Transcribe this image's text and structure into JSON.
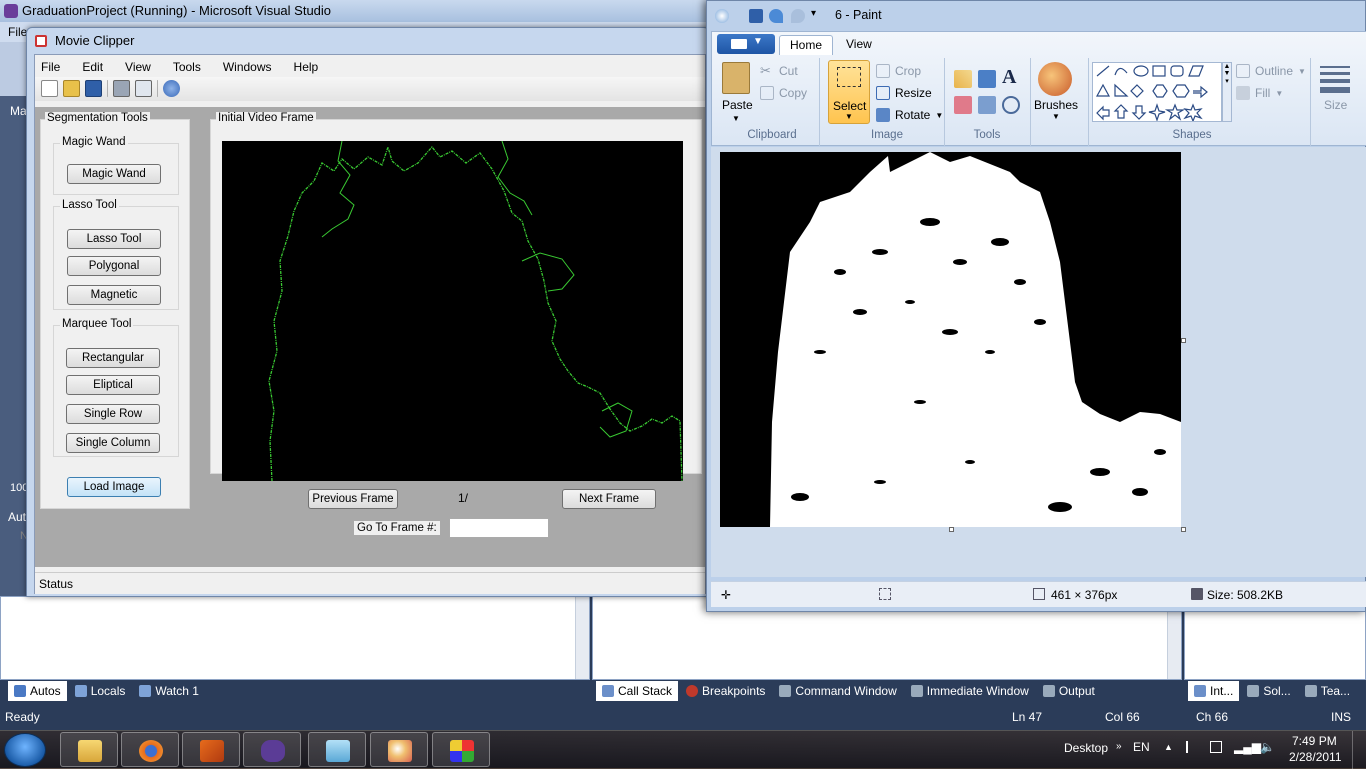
{
  "vs": {
    "title": "GraduationProject (Running) - Microsoft Visual Studio",
    "menu_first": "File",
    "left_labels": [
      "Ma",
      "100",
      "Auto",
      "N"
    ],
    "bottom_left_tabs": [
      "Autos",
      "Locals",
      "Watch 1"
    ],
    "bottom_mid_tabs": [
      "Call Stack",
      "Breakpoints",
      "Command Window",
      "Immediate Window",
      "Output"
    ],
    "bottom_right_tabs": [
      "Int...",
      "Sol...",
      "Tea..."
    ],
    "status": {
      "ready": "Ready",
      "ln": "Ln 47",
      "col": "Col 66",
      "ch": "Ch 66",
      "ins": "INS"
    }
  },
  "movie_clipper": {
    "title": "Movie Clipper",
    "menu": [
      "File",
      "Edit",
      "View",
      "Tools",
      "Windows",
      "Help"
    ],
    "toolbar_icons": [
      "new-icon",
      "open-icon",
      "save-icon",
      "print-icon",
      "print-preview-icon",
      "globe-icon"
    ],
    "segmentation_title": "Segmentation Tools",
    "magic_wand_group": "Magic Wand",
    "magic_wand_btn": "Magic Wand",
    "lasso_group": "Lasso Tool",
    "lasso_btn": "Lasso Tool",
    "polygonal_btn": "Polygonal",
    "magnetic_btn": "Magnetic",
    "marquee_group": "Marquee Tool",
    "rectangular_btn": "Rectangular",
    "eliptical_btn": "Eliptical",
    "single_row_btn": "Single Row",
    "single_column_btn": "Single Column",
    "load_image_btn": "Load Image",
    "video_group": "Initial Video Frame",
    "prev_btn": "Previous Frame",
    "frame_counter": "1/",
    "next_btn": "Next Frame",
    "goto_label": "Go To Frame #:",
    "goto_value": "",
    "status": "Status"
  },
  "paint": {
    "title": "6 - Paint",
    "tabs": [
      "Home",
      "View"
    ],
    "clipboard": {
      "paste": "Paste",
      "cut": "Cut",
      "copy": "Copy",
      "label": "Clipboard"
    },
    "image": {
      "select": "Select",
      "crop": "Crop",
      "resize": "Resize",
      "rotate": "Rotate",
      "label": "Image"
    },
    "tools_label": "Tools",
    "brushes": "Brushes",
    "shapes": {
      "outline": "Outline",
      "fill": "Fill",
      "label": "Shapes"
    },
    "size": "Size",
    "status": {
      "dimensions": "461 × 376px",
      "size": "Size: 508.2KB"
    }
  },
  "taskbar": {
    "desktop": "Desktop",
    "lang": "EN",
    "time": "7:49 PM",
    "date": "2/28/2011",
    "apps": [
      "explorer-icon",
      "firefox-icon",
      "matlab-icon",
      "visual-studio-icon",
      "notepad-icon",
      "paint-icon",
      "color-app-icon"
    ]
  }
}
